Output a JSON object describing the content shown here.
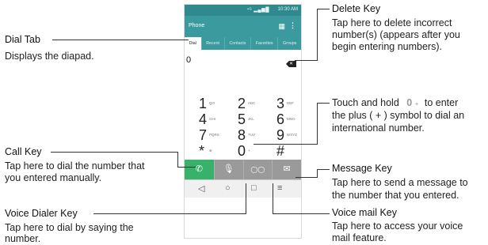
{
  "phone": {
    "status_signal": "⁴ᴳ ▂▄▆█",
    "status_time": "10:30 AM",
    "app_title": "Phone",
    "tabs": [
      "Dial",
      "Recent",
      "Contacts",
      "Favorites",
      "Groups"
    ],
    "entered_number": "0",
    "keys": [
      {
        "digit": "1",
        "letters": "QO"
      },
      {
        "digit": "2",
        "letters": "ABC"
      },
      {
        "digit": "3",
        "letters": "DEF"
      },
      {
        "digit": "4",
        "letters": "GHI"
      },
      {
        "digit": "5",
        "letters": "JKL"
      },
      {
        "digit": "6",
        "letters": "MNO"
      },
      {
        "digit": "7",
        "letters": "PQRS"
      },
      {
        "digit": "8",
        "letters": "TUV"
      },
      {
        "digit": "9",
        "letters": "WXYZ"
      },
      {
        "digit": "*",
        "letters": "⊕"
      },
      {
        "digit": "0",
        "letters": "+"
      },
      {
        "digit": "#",
        "letters": ""
      }
    ],
    "icons": {
      "grid": "grid-icon",
      "overflow": "more-vert-icon",
      "delete": "backspace-icon",
      "call": "phone-icon",
      "voice": "microphone-icon",
      "voicemail": "voicemail-icon",
      "message": "message-icon",
      "back": "back-icon",
      "home": "home-icon",
      "recent": "recent-apps-icon",
      "menu": "menu-icon"
    },
    "colors": {
      "header": "#3a9a9e",
      "status": "#2f8a8e",
      "call": "#38b26a",
      "action_gray": "#9a9a9a"
    }
  },
  "callouts": {
    "dial_tab": {
      "title": "Dial Tab",
      "desc": [
        "Displays the diapad."
      ]
    },
    "call_key": {
      "title": "Call Key",
      "desc": [
        "Tap here to dial the number that",
        "you entered manually."
      ]
    },
    "voice_dialer": {
      "title": "Voice Dialer Key",
      "desc": [
        "Tap here to dial by saying the",
        "number."
      ]
    },
    "delete_key": {
      "title": "Delete Key",
      "desc": [
        "Tap here to delete incorrect",
        "number(s) (appears after you",
        "begin entering numbers)."
      ]
    },
    "plus_symbol": {
      "lines": [
        "Touch and hold",
        "to enter",
        "the plus ( + ) symbol to dial an",
        "international number."
      ],
      "key_digit": "0",
      "key_sign": "+"
    },
    "message_key": {
      "title": "Message Key",
      "desc": [
        "Tap here to send a message to",
        "the number that you entered."
      ]
    },
    "voicemail_key": {
      "title": "Voice mail Key",
      "desc": [
        "Tap here to access your voice",
        "mail feature."
      ]
    }
  }
}
